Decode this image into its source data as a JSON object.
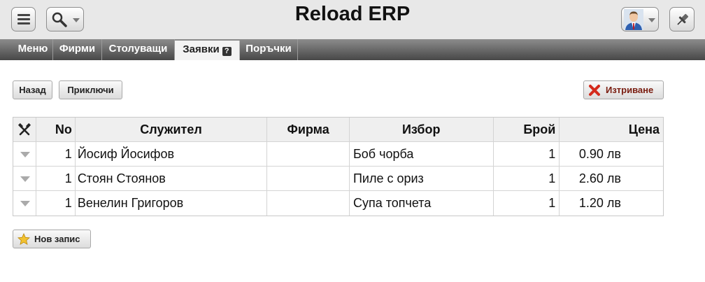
{
  "app": {
    "title": "Reload ERP"
  },
  "header": {
    "menu_icon": "hamburger-icon",
    "search_icon": "magnifier-icon",
    "user_icon": "user-avatar-icon",
    "pin_icon": "pushpin-icon"
  },
  "tabs": [
    {
      "label": "Меню",
      "active": false
    },
    {
      "label": "Фирми",
      "active": false
    },
    {
      "label": "Столуващи",
      "active": false
    },
    {
      "label": "Заявки",
      "active": true,
      "help": "?"
    },
    {
      "label": "Поръчки",
      "active": false
    }
  ],
  "actions": {
    "back": "Назад",
    "close": "Приключи",
    "delete": "Изтриване",
    "new_record": "Нов запис"
  },
  "table": {
    "columns": [
      "No",
      "Служител",
      "Фирма",
      "Избор",
      "Брой",
      "Цена"
    ],
    "rows": [
      {
        "no": "1",
        "employee": "Йосиф Йосифов",
        "company": "",
        "choice": "Боб чорба",
        "count": "1",
        "price": "0.90 лв"
      },
      {
        "no": "1",
        "employee": "Стоян Стоянов",
        "company": "",
        "choice": "Пиле с ориз",
        "count": "1",
        "price": "2.60 лв"
      },
      {
        "no": "1",
        "employee": "Венелин Григоров",
        "company": "",
        "choice": "Супа топчета",
        "count": "1",
        "price": "1.20 лв"
      }
    ]
  },
  "colors": {
    "header_bg": "#e8e8e8",
    "tabbar_dark": "#474747",
    "delete_text": "#7a1d10",
    "delete_icon": "#d42a1c",
    "star_icon": "#f2c230"
  }
}
